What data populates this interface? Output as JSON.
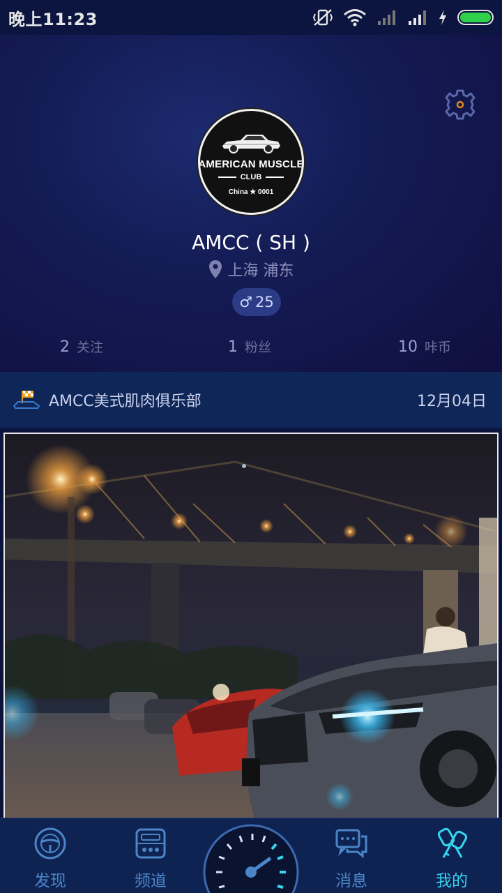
{
  "status_bar": {
    "time": "晚上11:23",
    "battery_level": 1.0,
    "battery_color": "#2fd14a"
  },
  "profile": {
    "avatar": {
      "line1": "AMERICAN MUSCLE",
      "line2": "CLUB",
      "line3": "China ★ 0001"
    },
    "username": "AMCC ( SH )",
    "location": "上海 浦东",
    "gender_symbol": "♂",
    "age": "25",
    "stats": [
      {
        "num": "2",
        "label": "关注"
      },
      {
        "num": "1",
        "label": "粉丝"
      },
      {
        "num": "10",
        "label": "咔币"
      }
    ],
    "icons": {
      "settings": "gear-icon",
      "location": "location-pin-icon"
    }
  },
  "club": {
    "icon": "racing-flag-car-icon",
    "name": "AMCC美式肌肉俱乐部",
    "date": "12月04日"
  },
  "photo": {
    "subject": "night-cars-under-bridge"
  },
  "bottom_nav": {
    "items": [
      {
        "label": "发现",
        "icon": "steering-wheel-icon",
        "active": false
      },
      {
        "label": "频道",
        "icon": "radio-channel-icon",
        "active": false
      },
      {
        "label": "",
        "icon": "speedometer-icon",
        "active": false
      },
      {
        "label": "消息",
        "icon": "chat-bubbles-icon",
        "active": false
      },
      {
        "label": "我的",
        "icon": "car-key-icon",
        "active": true
      }
    ]
  },
  "colors": {
    "accent": "#34d6f0",
    "nav_inactive": "#4a86c8",
    "header_bg": "#141c55",
    "club_row_bg": "#0f2658"
  }
}
